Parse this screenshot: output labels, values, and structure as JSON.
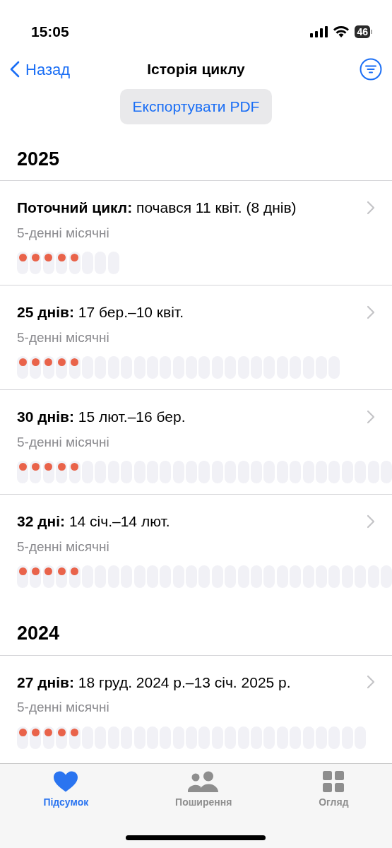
{
  "status_bar": {
    "time": "15:05",
    "battery": "46"
  },
  "nav": {
    "back": "Назад",
    "title": "Історія циклу"
  },
  "export_button": "Експортувати PDF",
  "sections": [
    {
      "year": "2025",
      "cycles": [
        {
          "label": "Поточний цикл:",
          "dates": "почався 11 квіт. (8 днів)",
          "subtitle": "5-денні місячні",
          "days": [
            {
              "period": true
            },
            {
              "period": true
            },
            {
              "period": true
            },
            {
              "period": true
            },
            {
              "period": true
            },
            {
              "period": false
            },
            {
              "period": false
            },
            {
              "period": false
            }
          ]
        },
        {
          "label": "25 днів:",
          "dates": "17 бер.–10 квіт.",
          "subtitle": "5-денні місячні",
          "days": [
            {
              "period": true
            },
            {
              "period": true
            },
            {
              "period": true
            },
            {
              "period": true
            },
            {
              "period": true
            },
            {
              "period": false
            },
            {
              "period": false
            },
            {
              "period": false
            },
            {
              "period": false
            },
            {
              "period": false
            },
            {
              "period": false
            },
            {
              "period": false
            },
            {
              "period": false
            },
            {
              "period": false
            },
            {
              "period": false
            },
            {
              "period": false
            },
            {
              "period": false
            },
            {
              "period": false
            },
            {
              "period": false
            },
            {
              "period": false
            },
            {
              "period": false
            },
            {
              "period": false
            },
            {
              "period": false
            },
            {
              "period": false
            },
            {
              "period": false
            }
          ]
        },
        {
          "label": "30 днів:",
          "dates": "15 лют.–16 бер.",
          "subtitle": "5-денні місячні",
          "days": [
            {
              "period": true
            },
            {
              "period": true
            },
            {
              "period": true
            },
            {
              "period": true
            },
            {
              "period": true
            },
            {
              "period": false
            },
            {
              "period": false
            },
            {
              "period": false
            },
            {
              "period": false
            },
            {
              "period": false
            },
            {
              "period": false
            },
            {
              "period": false
            },
            {
              "period": false
            },
            {
              "period": false
            },
            {
              "period": false
            },
            {
              "period": false
            },
            {
              "period": false
            },
            {
              "period": false
            },
            {
              "period": false
            },
            {
              "period": false
            },
            {
              "period": false
            },
            {
              "period": false
            },
            {
              "period": false
            },
            {
              "period": false
            },
            {
              "period": false
            },
            {
              "period": false
            },
            {
              "period": false
            },
            {
              "period": false
            },
            {
              "period": false
            }
          ]
        },
        {
          "label": "32 дні:",
          "dates": "14 січ.–14 лют.",
          "subtitle": "5-денні місячні",
          "days": [
            {
              "period": true
            },
            {
              "period": true
            },
            {
              "period": true
            },
            {
              "period": true
            },
            {
              "period": true
            },
            {
              "period": false
            },
            {
              "period": false
            },
            {
              "period": false
            },
            {
              "period": false
            },
            {
              "period": false
            },
            {
              "period": false
            },
            {
              "period": false
            },
            {
              "period": false
            },
            {
              "period": false
            },
            {
              "period": false
            },
            {
              "period": false
            },
            {
              "period": false
            },
            {
              "period": false
            },
            {
              "period": false
            },
            {
              "period": false
            },
            {
              "period": false
            },
            {
              "period": false
            },
            {
              "period": false
            },
            {
              "period": false
            },
            {
              "period": false
            },
            {
              "period": false
            },
            {
              "period": false
            },
            {
              "period": false
            },
            {
              "period": false
            }
          ]
        }
      ]
    },
    {
      "year": "2024",
      "cycles": [
        {
          "label": "27 днів:",
          "dates": "18 груд. 2024 р.–13 січ. 2025 р.",
          "subtitle": "5-денні місячні",
          "days": [
            {
              "period": true
            },
            {
              "period": true
            },
            {
              "period": true
            },
            {
              "period": true
            },
            {
              "period": true
            },
            {
              "period": false
            },
            {
              "period": false
            },
            {
              "period": false
            },
            {
              "period": false
            },
            {
              "period": false
            },
            {
              "period": false
            },
            {
              "period": false
            },
            {
              "period": false
            },
            {
              "period": false
            },
            {
              "period": false
            },
            {
              "period": false
            },
            {
              "period": false
            },
            {
              "period": false
            },
            {
              "period": false
            },
            {
              "period": false
            },
            {
              "period": false
            },
            {
              "period": false
            },
            {
              "period": false
            },
            {
              "period": false
            },
            {
              "period": false
            },
            {
              "period": false
            },
            {
              "period": false
            }
          ]
        }
      ]
    }
  ],
  "tabs": [
    {
      "kind": "heart",
      "label": "Підсумок",
      "selected": true
    },
    {
      "kind": "people",
      "label": "Поширення",
      "selected": false
    },
    {
      "kind": "grid",
      "label": "Огляд",
      "selected": false
    }
  ]
}
